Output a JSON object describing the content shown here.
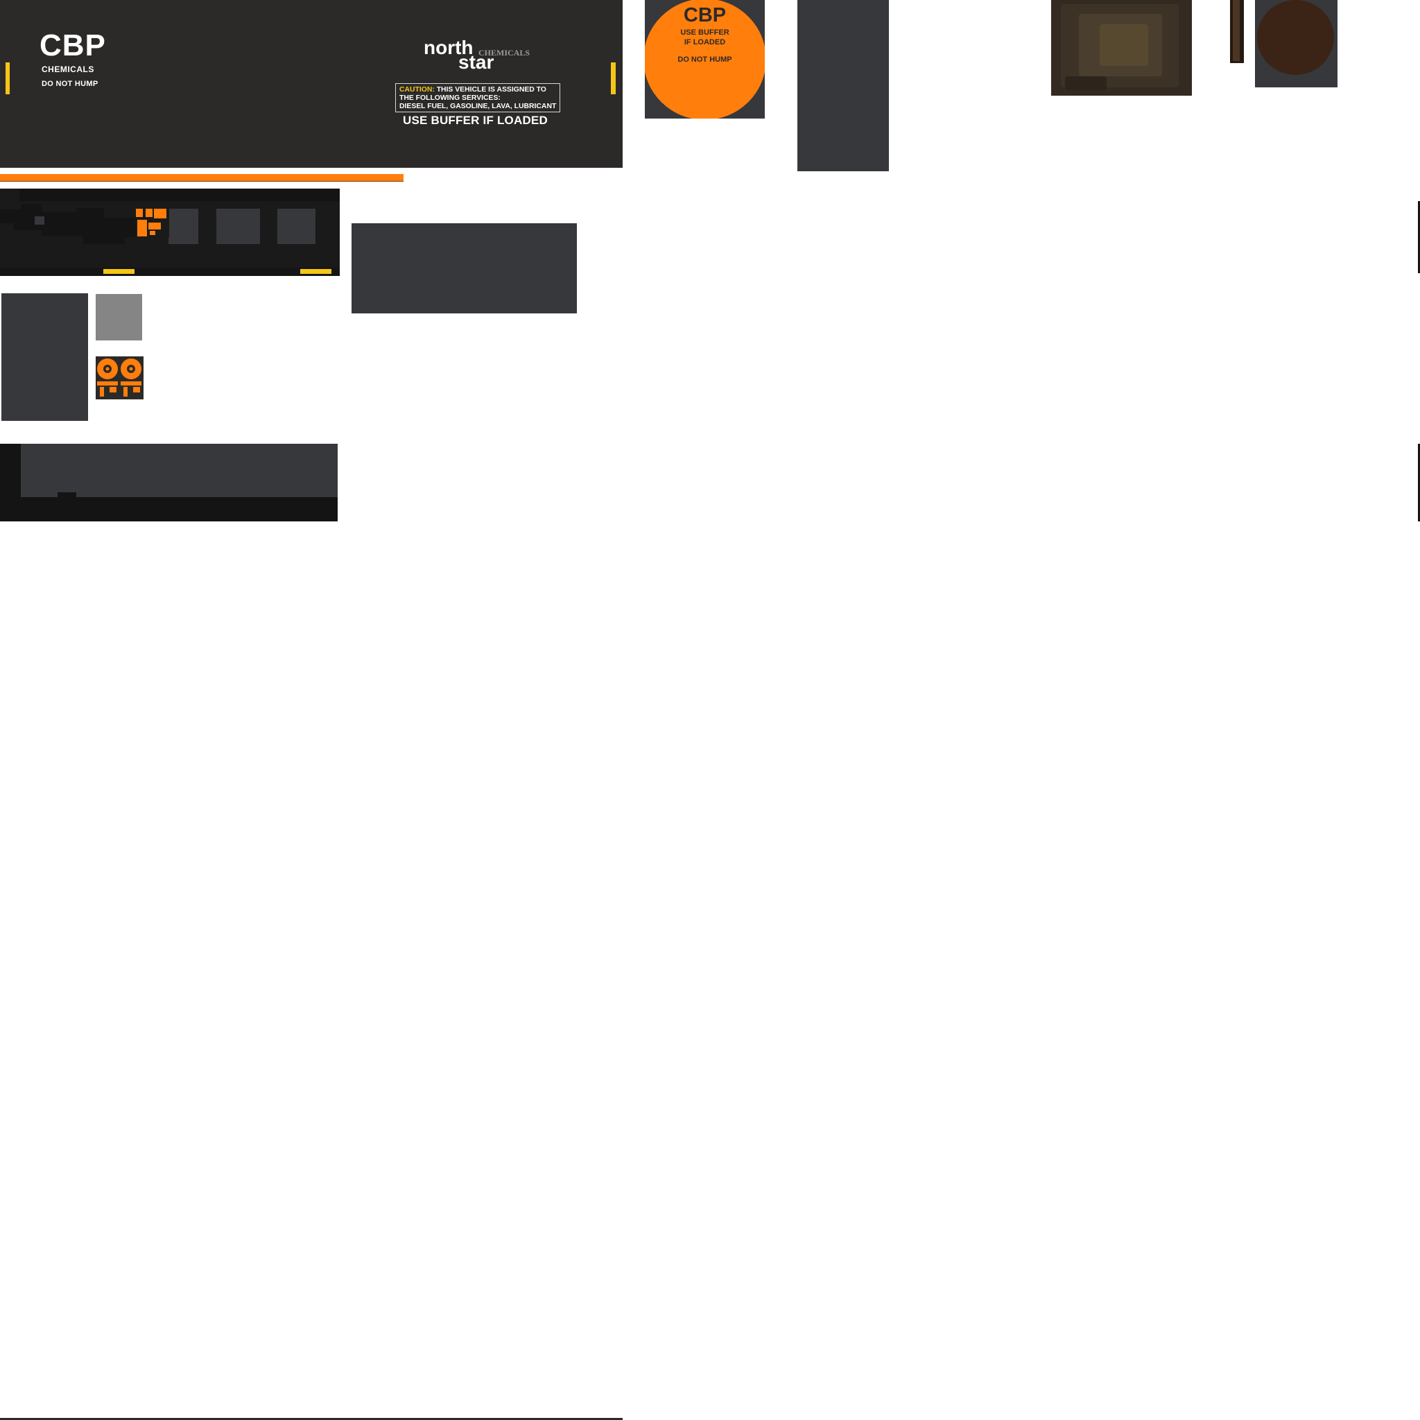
{
  "colors": {
    "panel_dark": "#2c2a29",
    "panel_slate": "#37383b",
    "accent_orange": "#ff7e0c",
    "accent_yellow": "#f5c518",
    "background": "#ffffff"
  },
  "side_panel": {
    "cbp_title": "CBP",
    "cbp_subtitle": "CHEMICALS",
    "cbp_notice": "DO NOT HUMP",
    "brand_north": "north",
    "brand_star": "star",
    "brand_chemicals": "CHEMICALS",
    "caution_label": "CAUTION:",
    "caution_line1": "THIS VEHICLE IS ASSIGNED TO",
    "caution_line2": "THE FOLLOWING SERVICES:",
    "caution_line3": "DIESEL FUEL, GASOLINE, LAVA, LUBRICANT",
    "buffer_notice": "USE BUFFER IF LOADED"
  },
  "circle_decal": {
    "title": "CBP",
    "line1": "USE BUFFER",
    "line2": "IF LOADED",
    "notice": "DO NOT HUMP"
  }
}
